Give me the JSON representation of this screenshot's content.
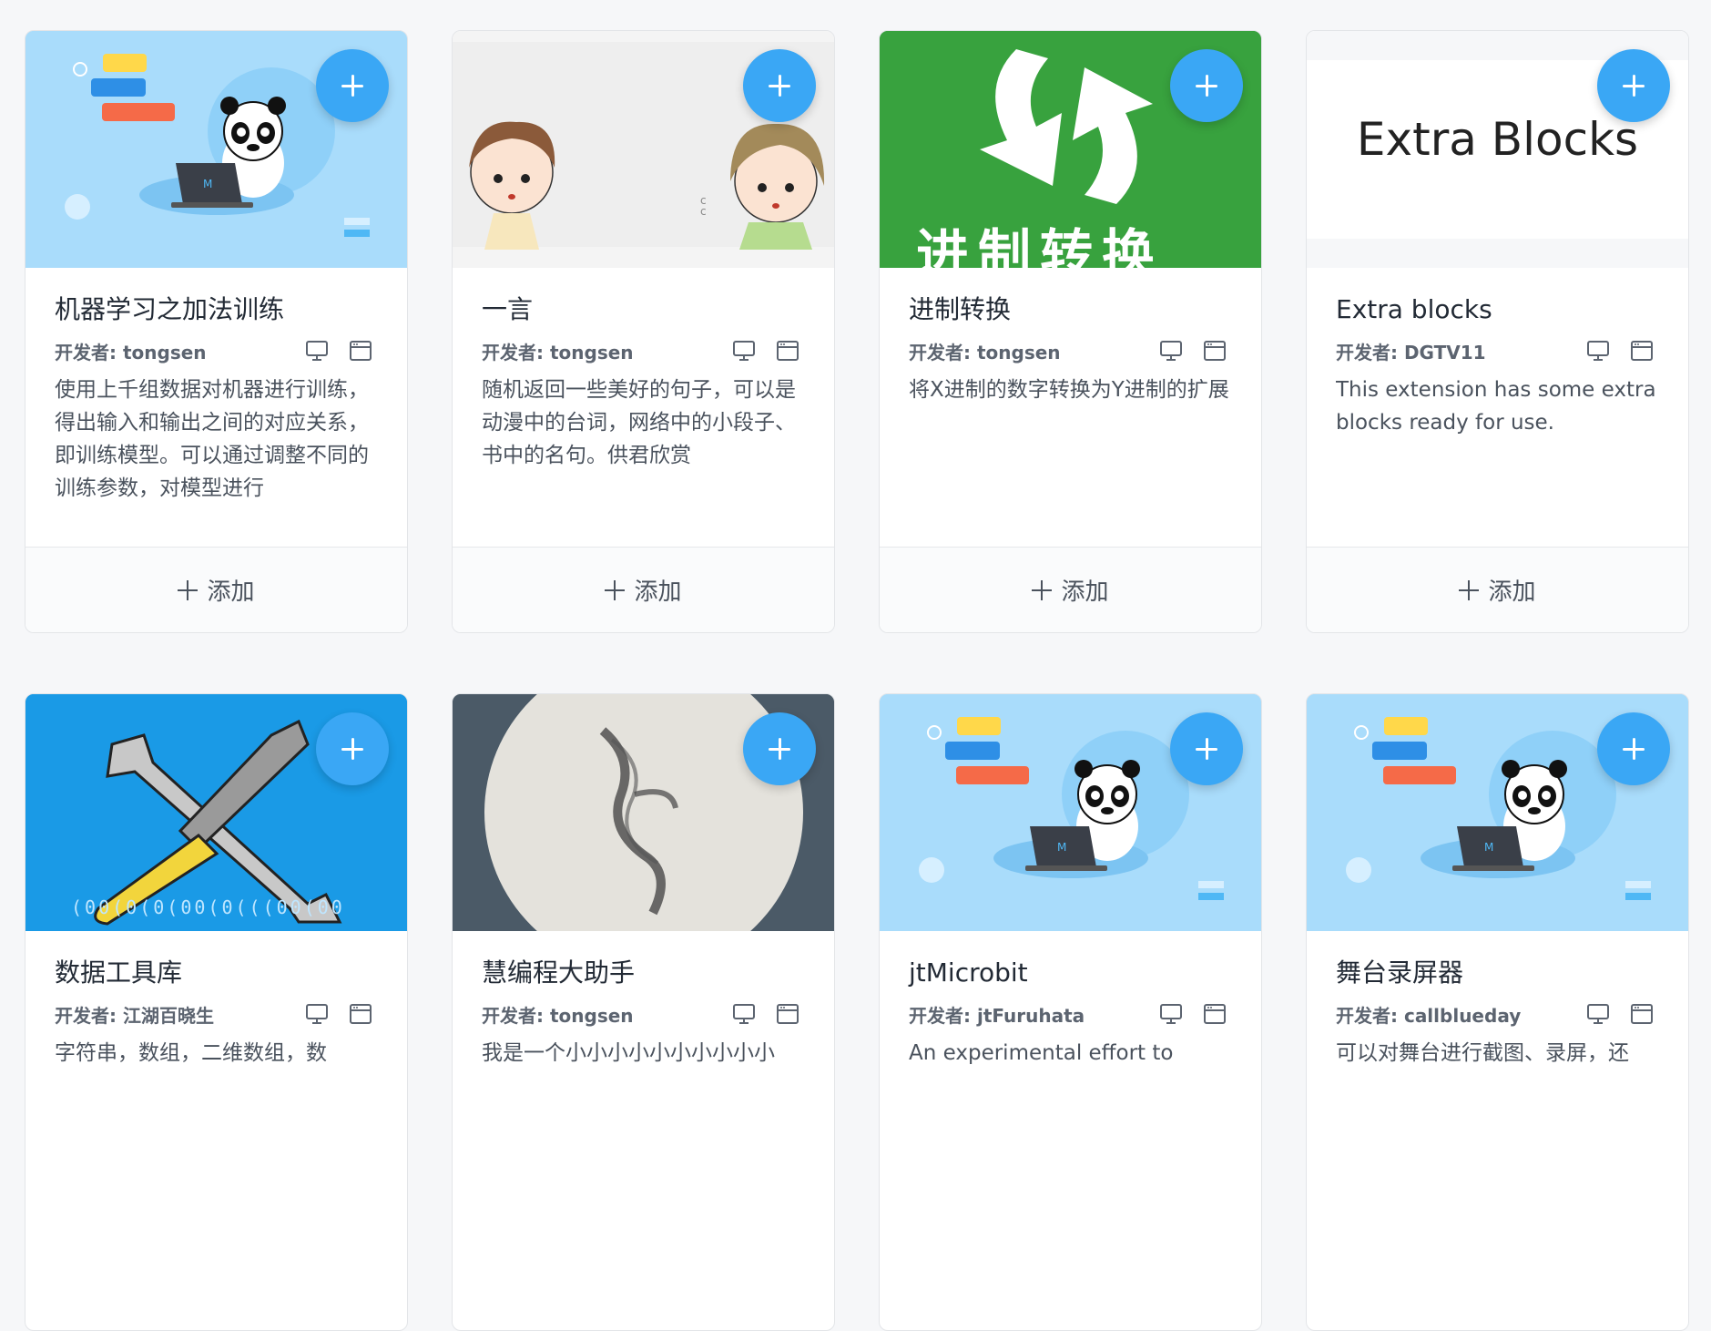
{
  "colors": {
    "accent": "#3aa7f5",
    "panda_bg": "#a9dcfb",
    "convert_bg": "#38a23e",
    "tools_bg": "#1a9ae6",
    "smoke_bg": "#4b5a67"
  },
  "cards": [
    {
      "title": "机器学习之加法训练",
      "developer": "开发者: tongsen",
      "description": "使用上千组数据对机器进行训练，得出输入和输出之间的对应关系，即训练模型。可以通过调整不同的训练参数，对模型进行",
      "add_label": "添加",
      "thumb": "panda-laptop"
    },
    {
      "title": "一言",
      "developer": "开发者: tongsen",
      "description": "随机返回一些美好的句子，可以是动漫中的台词，网络中的小段子、书中的名句。供君欣赏",
      "add_label": "添加",
      "thumb": "anime-girls"
    },
    {
      "title": "进制转换",
      "developer": "开发者: tongsen",
      "description": "将X进制的数字转换为Y进制的扩展",
      "add_label": "添加",
      "thumb": "convert-arrows",
      "thumb_text": "进制转换"
    },
    {
      "title": "Extra blocks",
      "developer": "开发者: DGTV11",
      "description": "This extension has some extra blocks ready for use.",
      "add_label": "添加",
      "thumb": "extra-blocks",
      "thumb_text": "Extra Blocks"
    },
    {
      "title": "数据工具库",
      "developer": "开发者: 江湖百晓生",
      "description": "字符串，数组，二维数组，数",
      "thumb": "wrench-screwdriver",
      "thumb_text": "(00(0(0(00(0(((00(00"
    },
    {
      "title": "慧编程大助手",
      "developer": "开发者: tongsen",
      "description": "我是一个小小小小小小小小小小",
      "thumb": "smoke-circle"
    },
    {
      "title": "jtMicrobit",
      "developer": "开发者: jtFuruhata",
      "description": "An experimental effort to",
      "thumb": "panda-laptop"
    },
    {
      "title": "舞台录屏器",
      "developer": "开发者: callblueday",
      "description": "可以对舞台进行截图、录屏，还",
      "thumb": "panda-laptop"
    }
  ]
}
